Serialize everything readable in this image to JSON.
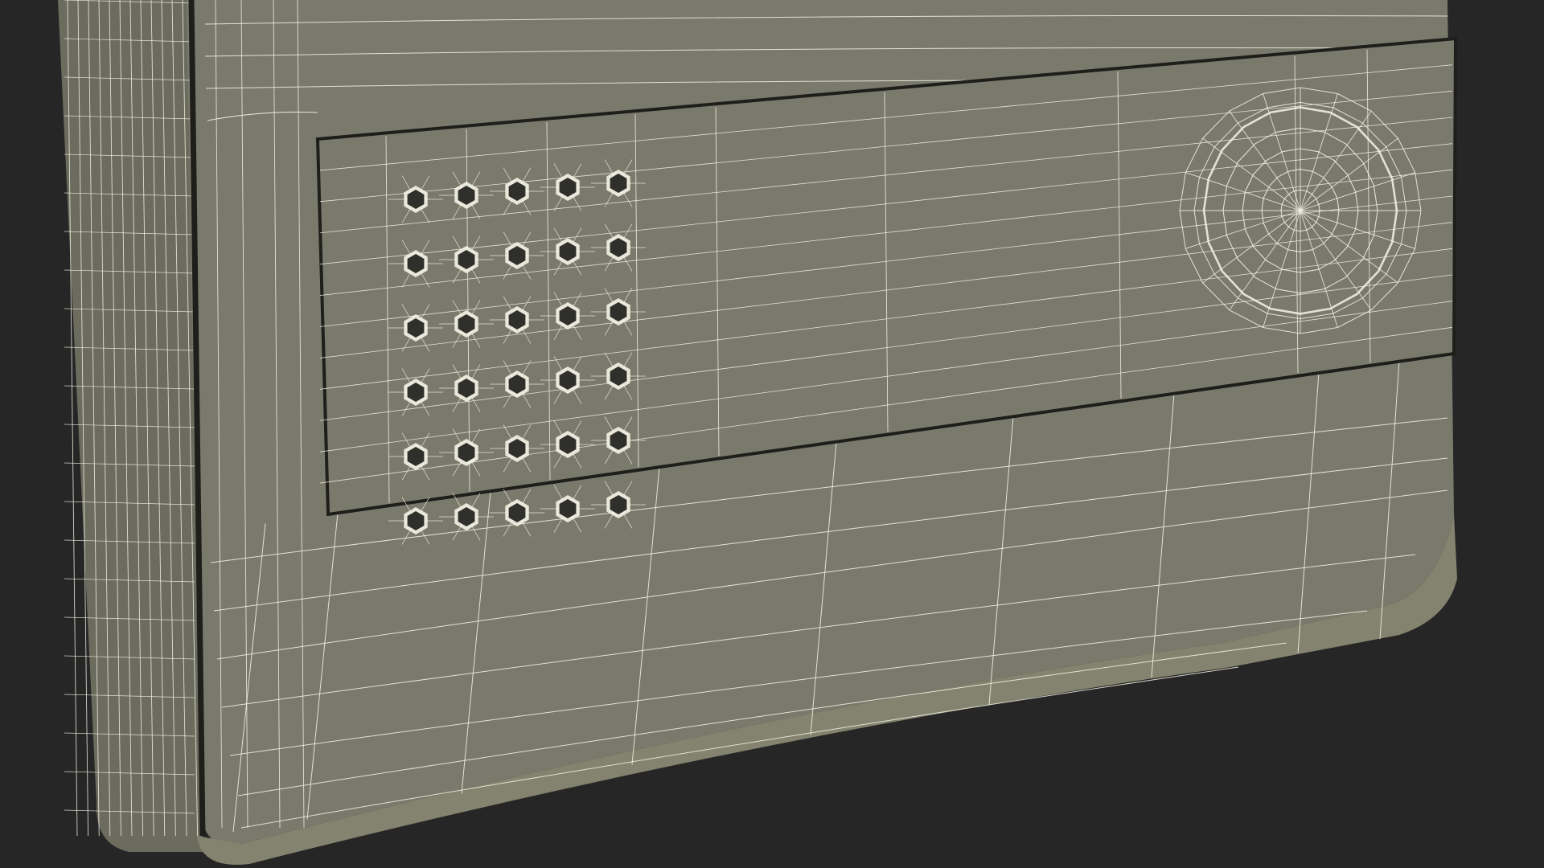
{
  "scene": {
    "subject": "wireframe-render-device-panel",
    "colors": {
      "background": "#262626",
      "body_fill": "#7a7a6c",
      "body_fill_light": "#83836f",
      "body_fill_dark": "#6b6b5e",
      "wire": "#f4f3e6",
      "seam": "#1e1e1a",
      "hole": "#2f2f2b"
    },
    "speaker_grille": {
      "rows": 6,
      "columns": 5
    },
    "round_button": {
      "rings": 5,
      "segments": 20
    }
  }
}
